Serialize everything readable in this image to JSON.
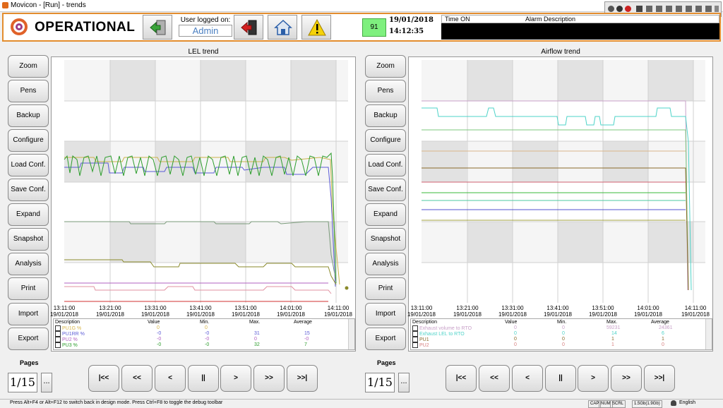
{
  "window": {
    "title": "Movicon - [Run] - trends"
  },
  "header": {
    "status": "OPERATIONAL",
    "user_label": "User logged on:",
    "user_value": "Admin",
    "counter": "91",
    "date": "19/01/2018",
    "time": "14:12:35",
    "alarm_col_time": "Time ON",
    "alarm_col_desc": "Alarm Description"
  },
  "side_buttons": [
    "Zoom",
    "Pens",
    "Backup",
    "Configure",
    "Load Conf.",
    "Save Conf.",
    "Expand",
    "Snapshot",
    "Analysis",
    "Print",
    "Import",
    "Export"
  ],
  "left_pane": {
    "title": "LEL trend",
    "ticks": [
      {
        "t": "13:11:00",
        "d": "19/01/2018"
      },
      {
        "t": "13:21:00",
        "d": "19/01/2018"
      },
      {
        "t": "13:31:00",
        "d": "19/01/2018"
      },
      {
        "t": "13:41:00",
        "d": "19/01/2018"
      },
      {
        "t": "13:51:00",
        "d": "19/01/2018"
      },
      {
        "t": "14:01:00",
        "d": "19/01/2018"
      },
      {
        "t": "14:11:00",
        "d": "19/01/2018"
      }
    ],
    "legend_headers": {
      "desc": "Description",
      "value": "Value",
      "min": "Min.",
      "max": "Max.",
      "avg": "Average"
    },
    "legend_rows": [
      {
        "desc": "PU1G %",
        "value": "0",
        "min": "0",
        "max": "",
        "avg": "",
        "color": "#d9b64a"
      },
      {
        "desc": "PU1RR %",
        "value": "-0",
        "min": "-0",
        "max": "31",
        "avg": "15",
        "color": "#5b5bd6"
      },
      {
        "desc": "PU2 %",
        "value": "-0",
        "min": "-0",
        "max": "0",
        "avg": "-0",
        "color": "#b060c0"
      },
      {
        "desc": "PU3 %",
        "value": "-0",
        "min": "-0",
        "max": "32",
        "avg": "7",
        "color": "#2e9e2e"
      }
    ]
  },
  "right_pane": {
    "title": "Airflow trend",
    "ticks": [
      {
        "t": "13:11:00",
        "d": "19/01/2018"
      },
      {
        "t": "13:21:00",
        "d": "19/01/2018"
      },
      {
        "t": "13:31:00",
        "d": "19/01/2018"
      },
      {
        "t": "13:41:00",
        "d": "19/01/2018"
      },
      {
        "t": "13:51:00",
        "d": "19/01/2018"
      },
      {
        "t": "14:01:00",
        "d": "19/01/2018"
      },
      {
        "t": "14:11:00",
        "d": "19/01/2018"
      }
    ],
    "legend_headers": {
      "desc": "Description",
      "value": "Value",
      "min": "Min.",
      "max": "Max.",
      "avg": "Average"
    },
    "legend_rows": [
      {
        "desc": "Exhaust volume to RTO",
        "value": "0",
        "min": "0",
        "max": "59231",
        "avg": "24361",
        "color": "#c8a0c8"
      },
      {
        "desc": "Exhaust LEL to RTO",
        "value": "0",
        "min": "0",
        "max": "14",
        "avg": "6",
        "color": "#4ed3c8"
      },
      {
        "desc": "PU1",
        "value": "0",
        "min": "0",
        "max": "1",
        "avg": "1",
        "color": "#8a6a2a"
      },
      {
        "desc": "PU2",
        "value": "0",
        "min": "0",
        "max": "1",
        "avg": "0",
        "color": "#d88080"
      }
    ]
  },
  "pager_left": {
    "label": "Pages",
    "value": "1/15",
    "dots": "..."
  },
  "pager_right": {
    "label": "Pages",
    "value": "1/15",
    "dots": "..."
  },
  "nav_buttons": [
    "|<<",
    "<<",
    "<",
    "||",
    ">",
    ">>",
    ">>|"
  ],
  "statusbar": {
    "hint": "Press Alt+F4 or Alt+F12 to switch back in design mode. Press Ctrl+F8 to toggle the debug toolbar",
    "cap": "CAP",
    "num": "NUM",
    "scrl": "SCRL",
    "mem": "1.5Gb(1.9Gb)",
    "lang": "English"
  }
}
